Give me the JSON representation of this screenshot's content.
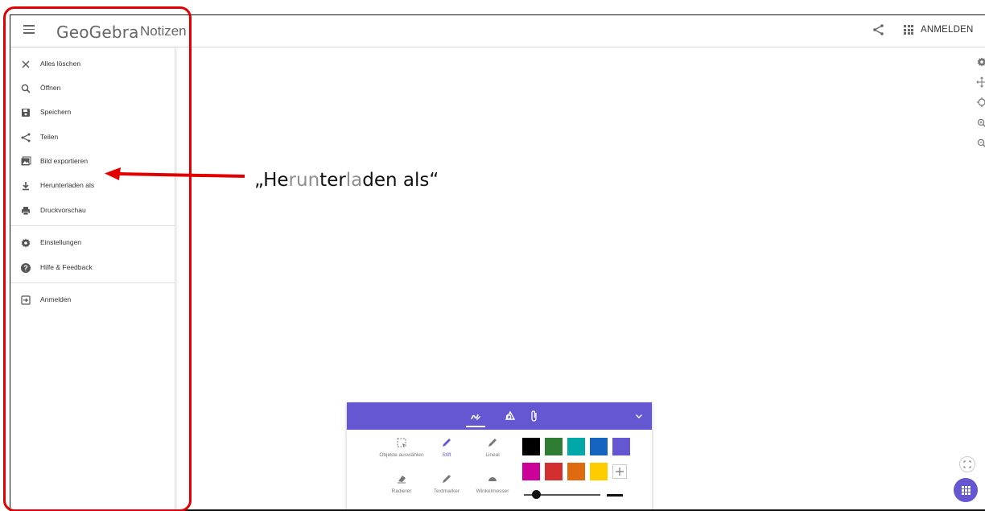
{
  "header": {
    "logo": "GeoGebra",
    "subtitle": "Notizen",
    "login_label": "ANMELDEN"
  },
  "sidebar": {
    "items": [
      {
        "label": "Alles löschen",
        "icon": "close-icon"
      },
      {
        "label": "Öffnen",
        "icon": "search-icon"
      },
      {
        "label": "Speichern",
        "icon": "save-icon"
      },
      {
        "label": "Teilen",
        "icon": "share-icon"
      },
      {
        "label": "Bild exportieren",
        "icon": "image-icon"
      },
      {
        "label": "Herunterladen als",
        "icon": "download-icon"
      },
      {
        "label": "Druckvorschau",
        "icon": "print-icon"
      },
      {
        "label": "Einstellungen",
        "icon": "gear-icon"
      },
      {
        "label": "Hilfe & Feedback",
        "icon": "help-icon"
      },
      {
        "label": "Anmelden",
        "icon": "sign-in-icon"
      }
    ]
  },
  "annotation": {
    "text_parts": [
      "„He",
      "run",
      "ter",
      "la",
      "den als“"
    ]
  },
  "toolbox": {
    "tools": [
      {
        "label": "Objekte auswählen",
        "icon": "select-icon"
      },
      {
        "label": "Stift",
        "icon": "pen-icon"
      },
      {
        "label": "Lineal",
        "icon": "ruler-icon"
      },
      {
        "label": "Radierer",
        "icon": "eraser-icon"
      },
      {
        "label": "Textmarker",
        "icon": "highlighter-icon"
      },
      {
        "label": "Winkelmesser",
        "icon": "protractor-icon"
      }
    ],
    "colors": [
      "#000000",
      "#2e7d32",
      "#00a8a8",
      "#1565c0",
      "#6557d2",
      "#cc0099",
      "#d32f2f",
      "#e06a10",
      "#ffcc00"
    ],
    "accent": "#6557d2"
  },
  "annotation_color": "#e20000"
}
